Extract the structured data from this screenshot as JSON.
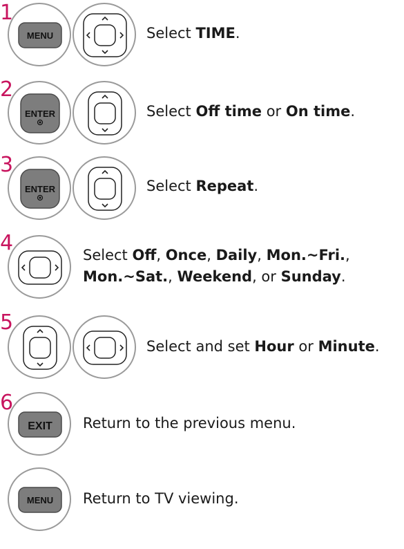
{
  "steps": [
    {
      "num": "1",
      "keys": [
        "MENU",
        "nav-4way"
      ],
      "parts": [
        {
          "t": "Select "
        },
        {
          "t": "TIME",
          "b": true
        },
        {
          "t": "."
        }
      ]
    },
    {
      "num": "2",
      "keys": [
        "ENTER",
        "nav-updown"
      ],
      "parts": [
        {
          "t": "Select "
        },
        {
          "t": "Off time",
          "b": true
        },
        {
          "t": " or "
        },
        {
          "t": "On time",
          "b": true
        },
        {
          "t": "."
        }
      ]
    },
    {
      "num": "3",
      "keys": [
        "ENTER",
        "nav-updown"
      ],
      "parts": [
        {
          "t": "Select "
        },
        {
          "t": "Repeat",
          "b": true
        },
        {
          "t": "."
        }
      ]
    },
    {
      "num": "4",
      "keys": [
        "nav-leftright"
      ],
      "line1": [
        {
          "t": "Select "
        },
        {
          "t": "Off",
          "b": true
        },
        {
          "t": ", "
        },
        {
          "t": "Once",
          "b": true
        },
        {
          "t": ", "
        },
        {
          "t": "Daily",
          "b": true
        },
        {
          "t": ", "
        },
        {
          "t": "Mon.~Fri.",
          "b": true
        },
        {
          "t": ","
        }
      ],
      "line2": [
        {
          "t": "Mon.~Sat.",
          "b": true
        },
        {
          "t": ", "
        },
        {
          "t": "Weekend",
          "b": true
        },
        {
          "t": ", or "
        },
        {
          "t": "Sunday",
          "b": true
        },
        {
          "t": "."
        }
      ]
    },
    {
      "num": "5",
      "keys": [
        "nav-updown",
        "nav-leftright"
      ],
      "parts": [
        {
          "t": "Select and set "
        },
        {
          "t": "Hour",
          "b": true
        },
        {
          "t": " or "
        },
        {
          "t": "Minute",
          "b": true
        },
        {
          "t": "."
        }
      ]
    },
    {
      "num": "6",
      "keys": [
        "EXIT"
      ],
      "parts": [
        {
          "t": "Return to the previous menu."
        }
      ]
    },
    {
      "num": "",
      "keys": [
        "MENU"
      ],
      "parts": [
        {
          "t": "Return to TV viewing."
        }
      ]
    }
  ],
  "key_labels": {
    "menu": "MENU",
    "enter": "ENTER",
    "exit": "EXIT"
  },
  "colors": {
    "step_number": "#c8145e",
    "button_fill": "#7d7d7d",
    "circle_border": "#9a9a9a"
  }
}
